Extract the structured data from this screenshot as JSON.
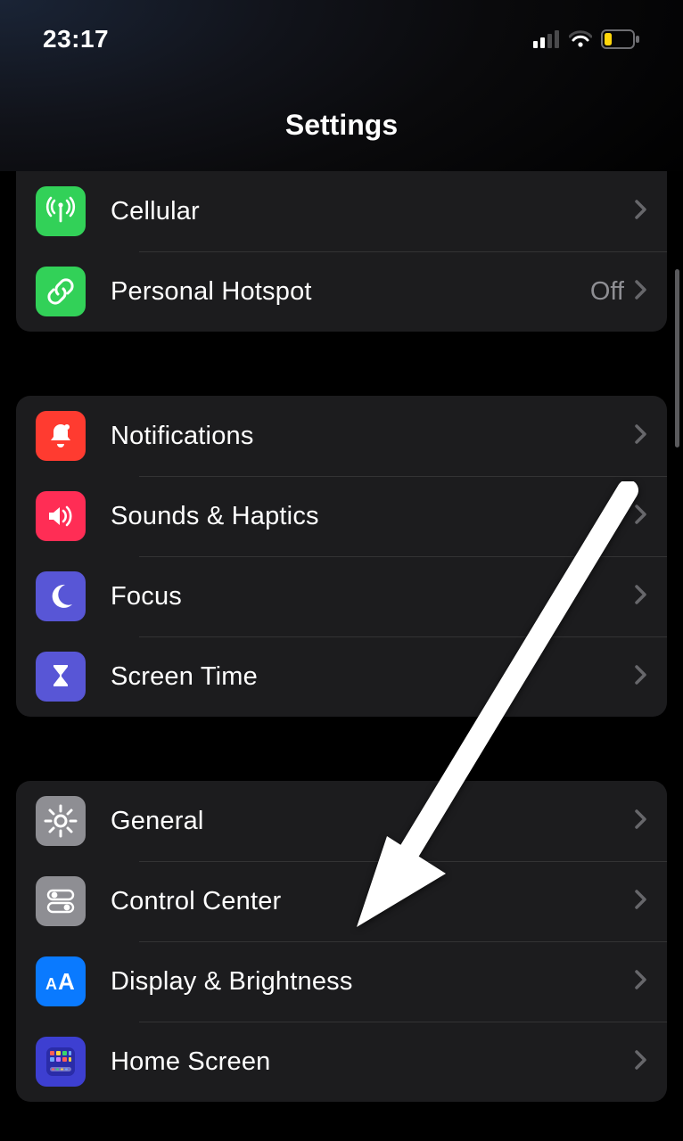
{
  "status": {
    "time": "23:17"
  },
  "header": {
    "title": "Settings"
  },
  "groups": [
    {
      "rows": [
        {
          "label": "Cellular",
          "value": "",
          "icon": "antenna",
          "bg": "#32d158"
        },
        {
          "label": "Personal Hotspot",
          "value": "Off",
          "icon": "link",
          "bg": "#32d158"
        }
      ]
    },
    {
      "rows": [
        {
          "label": "Notifications",
          "value": "",
          "icon": "bell",
          "bg": "#ff3b30"
        },
        {
          "label": "Sounds & Haptics",
          "value": "",
          "icon": "speaker",
          "bg": "#ff2d55"
        },
        {
          "label": "Focus",
          "value": "",
          "icon": "moon",
          "bg": "#5856d6"
        },
        {
          "label": "Screen Time",
          "value": "",
          "icon": "hourglass",
          "bg": "#5856d6"
        }
      ]
    },
    {
      "rows": [
        {
          "label": "General",
          "value": "",
          "icon": "gear",
          "bg": "#8e8e93"
        },
        {
          "label": "Control Center",
          "value": "",
          "icon": "switches",
          "bg": "#8e8e93"
        },
        {
          "label": "Display & Brightness",
          "value": "",
          "icon": "aa",
          "bg": "#0a7aff"
        },
        {
          "label": "Home Screen",
          "value": "",
          "icon": "grid",
          "bg": "#3d3fd1"
        }
      ]
    }
  ]
}
